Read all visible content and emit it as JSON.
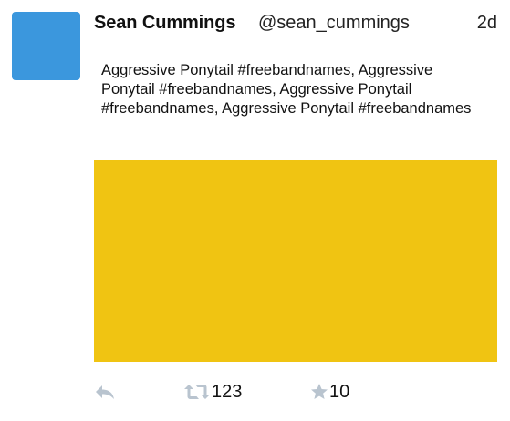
{
  "tweet": {
    "author_name": "Sean Cummings",
    "handle": "@sean_cummings",
    "timestamp": "2d",
    "text": "Aggressive Ponytail #freebandnames, Aggressive Ponytail #freebandnames, Aggressive Ponytail #freebandnames, Aggressive Ponytail #freebandnames",
    "avatar_color": "#3b97dd",
    "media_color": "#f0c412"
  },
  "actions": {
    "reply_icon": "reply-icon",
    "retweet_icon": "retweet-icon",
    "retweet_count": "123",
    "favorite_icon": "star-icon",
    "favorite_count": "10",
    "icon_color": "#b9c4cf"
  }
}
